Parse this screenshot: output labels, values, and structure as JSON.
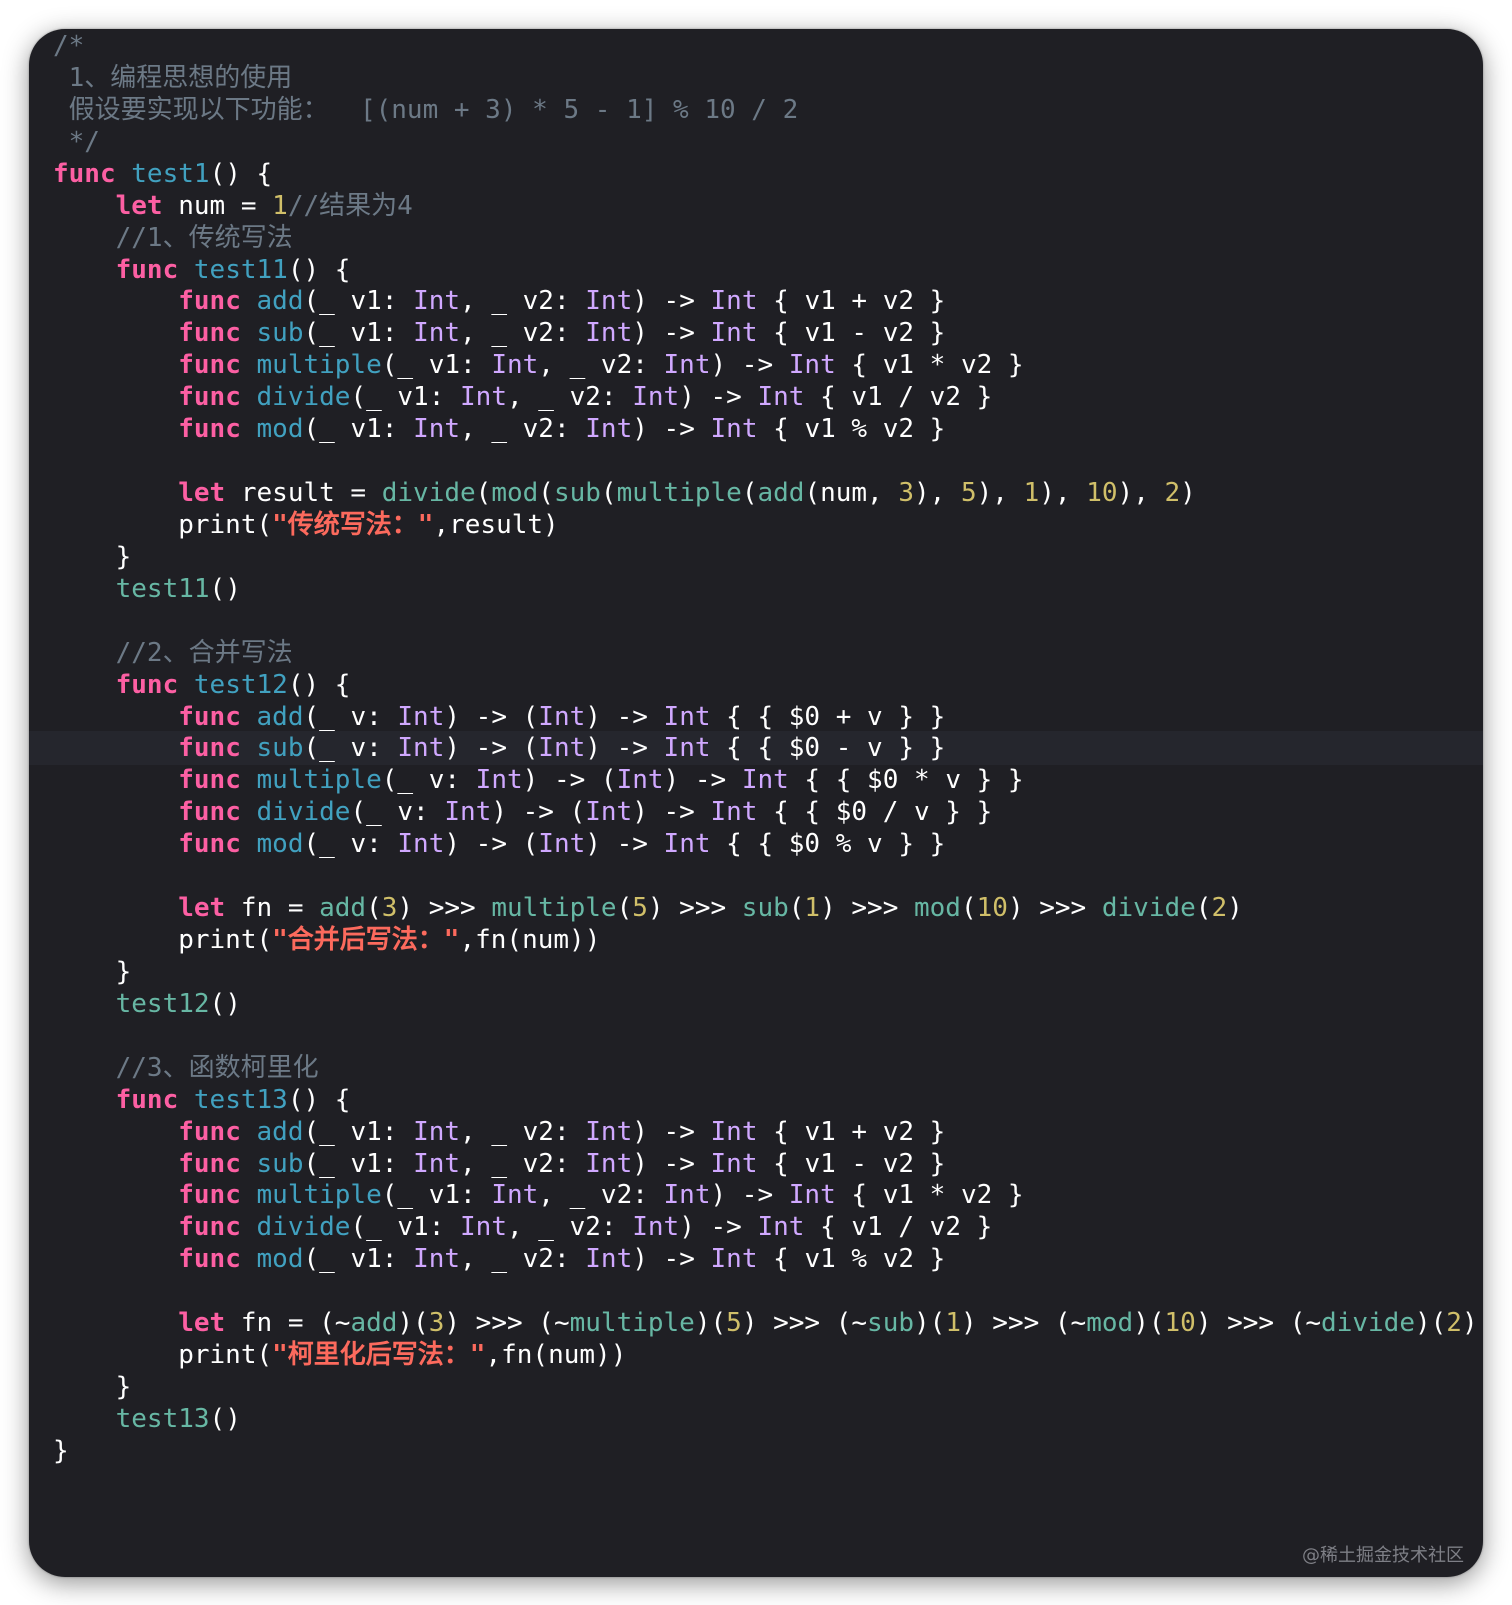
{
  "colors": {
    "background": "#1f1f24",
    "keyword": "#fc5fa3",
    "function_name": "#41a1c0",
    "type": "#d0a8ff",
    "number": "#d0bf69",
    "string": "#fc6a5d",
    "comment": "#6c7986",
    "call": "#67b7a4",
    "plain": "#ffffff"
  },
  "editor": {
    "highlighted_line": 22,
    "lines": [
      [
        [
          "comment",
          "/*"
        ]
      ],
      [
        [
          "comment",
          " 1、编程思想的使用"
        ]
      ],
      [
        [
          "comment",
          " 假设要实现以下功能：  [(num + 3) * 5 - 1] % 10 / 2"
        ]
      ],
      [
        [
          "comment",
          " */"
        ]
      ],
      [
        [
          "kw",
          "func "
        ],
        [
          "fn",
          "test1"
        ],
        [
          "plain",
          "() {"
        ]
      ],
      [
        [
          "plain",
          "    "
        ],
        [
          "kw",
          "let"
        ],
        [
          "plain",
          " num = "
        ],
        [
          "num",
          "1"
        ],
        [
          "comment",
          "//结果为4"
        ]
      ],
      [
        [
          "comment",
          "    //1、传统写法"
        ]
      ],
      [
        [
          "plain",
          "    "
        ],
        [
          "kw",
          "func "
        ],
        [
          "fn",
          "test11"
        ],
        [
          "plain",
          "() {"
        ]
      ],
      [
        [
          "plain",
          "        "
        ],
        [
          "kw",
          "func "
        ],
        [
          "fn",
          "add"
        ],
        [
          "plain",
          "(_ v1: "
        ],
        [
          "type",
          "Int"
        ],
        [
          "plain",
          ", _ v2: "
        ],
        [
          "type",
          "Int"
        ],
        [
          "plain",
          ") -> "
        ],
        [
          "type",
          "Int"
        ],
        [
          "plain",
          " { v1 + v2 }"
        ]
      ],
      [
        [
          "plain",
          "        "
        ],
        [
          "kw",
          "func "
        ],
        [
          "fn",
          "sub"
        ],
        [
          "plain",
          "(_ v1: "
        ],
        [
          "type",
          "Int"
        ],
        [
          "plain",
          ", _ v2: "
        ],
        [
          "type",
          "Int"
        ],
        [
          "plain",
          ") -> "
        ],
        [
          "type",
          "Int"
        ],
        [
          "plain",
          " { v1 - v2 }"
        ]
      ],
      [
        [
          "plain",
          "        "
        ],
        [
          "kw",
          "func "
        ],
        [
          "fn",
          "multiple"
        ],
        [
          "plain",
          "(_ v1: "
        ],
        [
          "type",
          "Int"
        ],
        [
          "plain",
          ", _ v2: "
        ],
        [
          "type",
          "Int"
        ],
        [
          "plain",
          ") -> "
        ],
        [
          "type",
          "Int"
        ],
        [
          "plain",
          " { v1 * v2 }"
        ]
      ],
      [
        [
          "plain",
          "        "
        ],
        [
          "kw",
          "func "
        ],
        [
          "fn",
          "divide"
        ],
        [
          "plain",
          "(_ v1: "
        ],
        [
          "type",
          "Int"
        ],
        [
          "plain",
          ", _ v2: "
        ],
        [
          "type",
          "Int"
        ],
        [
          "plain",
          ") -> "
        ],
        [
          "type",
          "Int"
        ],
        [
          "plain",
          " { v1 / v2 }"
        ]
      ],
      [
        [
          "plain",
          "        "
        ],
        [
          "kw",
          "func "
        ],
        [
          "fn",
          "mod"
        ],
        [
          "plain",
          "(_ v1: "
        ],
        [
          "type",
          "Int"
        ],
        [
          "plain",
          ", _ v2: "
        ],
        [
          "type",
          "Int"
        ],
        [
          "plain",
          ") -> "
        ],
        [
          "type",
          "Int"
        ],
        [
          "plain",
          " { v1 % v2 }"
        ]
      ],
      [
        [
          "plain",
          ""
        ]
      ],
      [
        [
          "plain",
          "        "
        ],
        [
          "kw",
          "let"
        ],
        [
          "plain",
          " result = "
        ],
        [
          "call",
          "divide"
        ],
        [
          "plain",
          "("
        ],
        [
          "call",
          "mod"
        ],
        [
          "plain",
          "("
        ],
        [
          "call",
          "sub"
        ],
        [
          "plain",
          "("
        ],
        [
          "call",
          "multiple"
        ],
        [
          "plain",
          "("
        ],
        [
          "call",
          "add"
        ],
        [
          "plain",
          "(num, "
        ],
        [
          "num",
          "3"
        ],
        [
          "plain",
          "), "
        ],
        [
          "num",
          "5"
        ],
        [
          "plain",
          "), "
        ],
        [
          "num",
          "1"
        ],
        [
          "plain",
          "), "
        ],
        [
          "num",
          "10"
        ],
        [
          "plain",
          "), "
        ],
        [
          "num",
          "2"
        ],
        [
          "plain",
          ")"
        ]
      ],
      [
        [
          "plain",
          "        print("
        ],
        [
          "str",
          "\"传统写法：\""
        ],
        [
          "plain",
          ",result)"
        ]
      ],
      [
        [
          "plain",
          "    }"
        ]
      ],
      [
        [
          "plain",
          "    "
        ],
        [
          "call",
          "test11"
        ],
        [
          "plain",
          "()"
        ]
      ],
      [
        [
          "plain",
          ""
        ]
      ],
      [
        [
          "comment",
          "    //2、合并写法"
        ]
      ],
      [
        [
          "plain",
          "    "
        ],
        [
          "kw",
          "func "
        ],
        [
          "fn",
          "test12"
        ],
        [
          "plain",
          "() {"
        ]
      ],
      [
        [
          "plain",
          "        "
        ],
        [
          "kw",
          "func "
        ],
        [
          "fn",
          "add"
        ],
        [
          "plain",
          "(_ v: "
        ],
        [
          "type",
          "Int"
        ],
        [
          "plain",
          ") -> ("
        ],
        [
          "type",
          "Int"
        ],
        [
          "plain",
          ") -> "
        ],
        [
          "type",
          "Int"
        ],
        [
          "plain",
          " { { $0 + v } }"
        ]
      ],
      [
        [
          "plain",
          "        "
        ],
        [
          "kw",
          "func "
        ],
        [
          "fn",
          "sub"
        ],
        [
          "plain",
          "(_ v: "
        ],
        [
          "type",
          "Int"
        ],
        [
          "plain",
          ") -> ("
        ],
        [
          "type",
          "Int"
        ],
        [
          "plain",
          ") -> "
        ],
        [
          "type",
          "Int"
        ],
        [
          "plain",
          " { { $0 - v } }"
        ]
      ],
      [
        [
          "plain",
          "        "
        ],
        [
          "kw",
          "func "
        ],
        [
          "fn",
          "multiple"
        ],
        [
          "plain",
          "(_ v: "
        ],
        [
          "type",
          "Int"
        ],
        [
          "plain",
          ") -> ("
        ],
        [
          "type",
          "Int"
        ],
        [
          "plain",
          ") -> "
        ],
        [
          "type",
          "Int"
        ],
        [
          "plain",
          " { { $0 * v } }"
        ]
      ],
      [
        [
          "plain",
          "        "
        ],
        [
          "kw",
          "func "
        ],
        [
          "fn",
          "divide"
        ],
        [
          "plain",
          "(_ v: "
        ],
        [
          "type",
          "Int"
        ],
        [
          "plain",
          ") -> ("
        ],
        [
          "type",
          "Int"
        ],
        [
          "plain",
          ") -> "
        ],
        [
          "type",
          "Int"
        ],
        [
          "plain",
          " { { $0 / v } }"
        ]
      ],
      [
        [
          "plain",
          "        "
        ],
        [
          "kw",
          "func "
        ],
        [
          "fn",
          "mod"
        ],
        [
          "plain",
          "(_ v: "
        ],
        [
          "type",
          "Int"
        ],
        [
          "plain",
          ") -> ("
        ],
        [
          "type",
          "Int"
        ],
        [
          "plain",
          ") -> "
        ],
        [
          "type",
          "Int"
        ],
        [
          "plain",
          " { { $0 % v } }"
        ]
      ],
      [
        [
          "plain",
          ""
        ]
      ],
      [
        [
          "plain",
          "        "
        ],
        [
          "kw",
          "let"
        ],
        [
          "plain",
          " fn = "
        ],
        [
          "call",
          "add"
        ],
        [
          "plain",
          "("
        ],
        [
          "num",
          "3"
        ],
        [
          "plain",
          ") >>> "
        ],
        [
          "call",
          "multiple"
        ],
        [
          "plain",
          "("
        ],
        [
          "num",
          "5"
        ],
        [
          "plain",
          ") >>> "
        ],
        [
          "call",
          "sub"
        ],
        [
          "plain",
          "("
        ],
        [
          "num",
          "1"
        ],
        [
          "plain",
          ") >>> "
        ],
        [
          "call",
          "mod"
        ],
        [
          "plain",
          "("
        ],
        [
          "num",
          "10"
        ],
        [
          "plain",
          ") >>> "
        ],
        [
          "call",
          "divide"
        ],
        [
          "plain",
          "("
        ],
        [
          "num",
          "2"
        ],
        [
          "plain",
          ")"
        ]
      ],
      [
        [
          "plain",
          "        print("
        ],
        [
          "str",
          "\"合并后写法：\""
        ],
        [
          "plain",
          ",fn(num))"
        ]
      ],
      [
        [
          "plain",
          "    }"
        ]
      ],
      [
        [
          "plain",
          "    "
        ],
        [
          "call",
          "test12"
        ],
        [
          "plain",
          "()"
        ]
      ],
      [
        [
          "plain",
          ""
        ]
      ],
      [
        [
          "comment",
          "    //3、函数柯里化"
        ]
      ],
      [
        [
          "plain",
          "    "
        ],
        [
          "kw",
          "func "
        ],
        [
          "fn",
          "test13"
        ],
        [
          "plain",
          "() {"
        ]
      ],
      [
        [
          "plain",
          "        "
        ],
        [
          "kw",
          "func "
        ],
        [
          "fn",
          "add"
        ],
        [
          "plain",
          "(_ v1: "
        ],
        [
          "type",
          "Int"
        ],
        [
          "plain",
          ", _ v2: "
        ],
        [
          "type",
          "Int"
        ],
        [
          "plain",
          ") -> "
        ],
        [
          "type",
          "Int"
        ],
        [
          "plain",
          " { v1 + v2 }"
        ]
      ],
      [
        [
          "plain",
          "        "
        ],
        [
          "kw",
          "func "
        ],
        [
          "fn",
          "sub"
        ],
        [
          "plain",
          "(_ v1: "
        ],
        [
          "type",
          "Int"
        ],
        [
          "plain",
          ", _ v2: "
        ],
        [
          "type",
          "Int"
        ],
        [
          "plain",
          ") -> "
        ],
        [
          "type",
          "Int"
        ],
        [
          "plain",
          " { v1 - v2 }"
        ]
      ],
      [
        [
          "plain",
          "        "
        ],
        [
          "kw",
          "func "
        ],
        [
          "fn",
          "multiple"
        ],
        [
          "plain",
          "(_ v1: "
        ],
        [
          "type",
          "Int"
        ],
        [
          "plain",
          ", _ v2: "
        ],
        [
          "type",
          "Int"
        ],
        [
          "plain",
          ") -> "
        ],
        [
          "type",
          "Int"
        ],
        [
          "plain",
          " { v1 * v2 }"
        ]
      ],
      [
        [
          "plain",
          "        "
        ],
        [
          "kw",
          "func "
        ],
        [
          "fn",
          "divide"
        ],
        [
          "plain",
          "(_ v1: "
        ],
        [
          "type",
          "Int"
        ],
        [
          "plain",
          ", _ v2: "
        ],
        [
          "type",
          "Int"
        ],
        [
          "plain",
          ") -> "
        ],
        [
          "type",
          "Int"
        ],
        [
          "plain",
          " { v1 / v2 }"
        ]
      ],
      [
        [
          "plain",
          "        "
        ],
        [
          "kw",
          "func "
        ],
        [
          "fn",
          "mod"
        ],
        [
          "plain",
          "(_ v1: "
        ],
        [
          "type",
          "Int"
        ],
        [
          "plain",
          ", _ v2: "
        ],
        [
          "type",
          "Int"
        ],
        [
          "plain",
          ") -> "
        ],
        [
          "type",
          "Int"
        ],
        [
          "plain",
          " { v1 % v2 }"
        ]
      ],
      [
        [
          "plain",
          ""
        ]
      ],
      [
        [
          "plain",
          "        "
        ],
        [
          "kw",
          "let"
        ],
        [
          "plain",
          " fn = (~"
        ],
        [
          "call",
          "add"
        ],
        [
          "plain",
          ")("
        ],
        [
          "num",
          "3"
        ],
        [
          "plain",
          ") >>> (~"
        ],
        [
          "call",
          "multiple"
        ],
        [
          "plain",
          ")("
        ],
        [
          "num",
          "5"
        ],
        [
          "plain",
          ") >>> (~"
        ],
        [
          "call",
          "sub"
        ],
        [
          "plain",
          ")("
        ],
        [
          "num",
          "1"
        ],
        [
          "plain",
          ") >>> (~"
        ],
        [
          "call",
          "mod"
        ],
        [
          "plain",
          ")("
        ],
        [
          "num",
          "10"
        ],
        [
          "plain",
          ") >>> (~"
        ],
        [
          "call",
          "divide"
        ],
        [
          "plain",
          ")("
        ],
        [
          "num",
          "2"
        ],
        [
          "plain",
          ")"
        ]
      ],
      [
        [
          "plain",
          "        print("
        ],
        [
          "str",
          "\"柯里化后写法：\""
        ],
        [
          "plain",
          ",fn(num))"
        ]
      ],
      [
        [
          "plain",
          "    }"
        ]
      ],
      [
        [
          "plain",
          "    "
        ],
        [
          "call",
          "test13"
        ],
        [
          "plain",
          "()"
        ]
      ],
      [
        [
          "plain",
          "}"
        ]
      ]
    ]
  },
  "watermark": "@稀土掘金技术社区"
}
